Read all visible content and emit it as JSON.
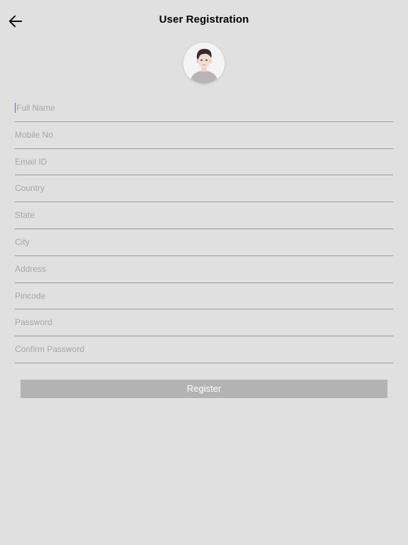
{
  "header": {
    "title": "User Registration",
    "back_icon": "arrow-left-icon"
  },
  "avatar": {
    "icon": "user-avatar-icon"
  },
  "form": {
    "fields": [
      {
        "placeholder": "Full Name",
        "value": ""
      },
      {
        "placeholder": "Mobile No",
        "value": ""
      },
      {
        "placeholder": "Email ID",
        "value": ""
      },
      {
        "placeholder": "Country",
        "value": ""
      },
      {
        "placeholder": "State",
        "value": ""
      },
      {
        "placeholder": "City",
        "value": ""
      },
      {
        "placeholder": "Address",
        "value": ""
      },
      {
        "placeholder": "Pincode",
        "value": ""
      },
      {
        "placeholder": "Password",
        "value": ""
      },
      {
        "placeholder": "Confirm Password",
        "value": ""
      }
    ],
    "register_label": "Register"
  },
  "colors": {
    "background": "#e0e0e0",
    "button": "#b3b3b3",
    "divider": "#9a9a9a",
    "placeholder": "#a6a6a6"
  }
}
